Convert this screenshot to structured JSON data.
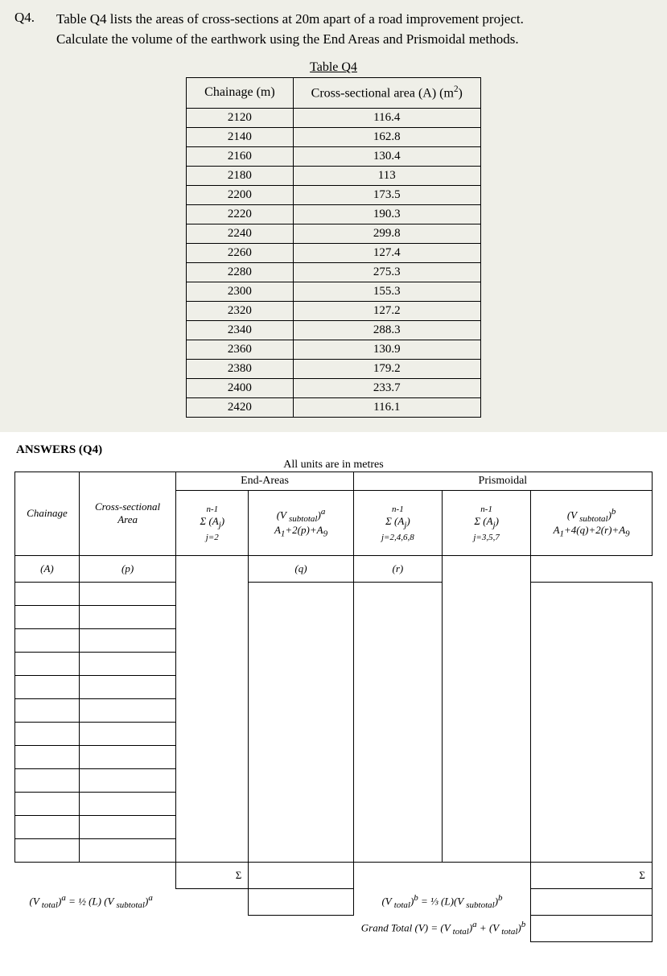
{
  "question": {
    "number": "Q4.",
    "text_line1": "Table Q4 lists the areas of cross-sections at 20m apart of a road improvement project.",
    "text_line2": "Calculate the volume of the earthwork using the End Areas and Prismoidal methods."
  },
  "data_table": {
    "caption": "Table Q4",
    "col1": "Chainage (m)",
    "col2_prefix": "Cross-sectional area (A)  (m",
    "col2_sup": "2",
    "col2_suffix": ")",
    "rows": [
      {
        "c": "2120",
        "a": "116.4"
      },
      {
        "c": "2140",
        "a": "162.8"
      },
      {
        "c": "2160",
        "a": "130.4"
      },
      {
        "c": "2180",
        "a": "113"
      },
      {
        "c": "2200",
        "a": "173.5"
      },
      {
        "c": "2220",
        "a": "190.3"
      },
      {
        "c": "2240",
        "a": "299.8"
      },
      {
        "c": "2260",
        "a": "127.4"
      },
      {
        "c": "2280",
        "a": "275.3"
      },
      {
        "c": "2300",
        "a": "155.3"
      },
      {
        "c": "2320",
        "a": "127.2"
      },
      {
        "c": "2340",
        "a": "288.3"
      },
      {
        "c": "2360",
        "a": "130.9"
      },
      {
        "c": "2380",
        "a": "179.2"
      },
      {
        "c": "2400",
        "a": "233.7"
      },
      {
        "c": "2420",
        "a": "116.1"
      }
    ]
  },
  "answers": {
    "title": "ANSWERS (Q4)",
    "units_note": "All units are in metres",
    "section_endareas": "End-Areas",
    "section_prismoidal": "Prismoidal",
    "headers": {
      "chainage": "Chainage",
      "cross_area_l1": "Cross-sectional",
      "cross_area_l2": "Area",
      "sum_top": "n-1",
      "sum_aj": "Σ (A",
      "sum_aj_sub": "j",
      "sum_aj_close": ")",
      "j2": "j=2",
      "j2468": "j=2,4,6,8",
      "j357": "j=3,5,7",
      "vsub_a_l1": "(V ",
      "vsub_sub": "subtotal",
      "vsub_close_a": ")",
      "sup_a": "a",
      "sup_b": "b",
      "vsub_a_l2_pre": "A",
      "vsub_a_l2_sub1": "1",
      "vsub_a_l2_mid": "+2(p)+A",
      "vsub_a_l2_sub9": "9",
      "vsub_b_l2_mid": "+4(q)+2(r)+A"
    },
    "row2": {
      "A": "(A)",
      "p": "(p)",
      "q": "(q)",
      "r": "(r)"
    },
    "sigma": "Σ",
    "formula_a_pre": "(V ",
    "formula_a_sub1": "total",
    "formula_a_mid": ")",
    "formula_a_eq": " = ½ (L) (V ",
    "formula_a_sub2": "subtotal",
    "formula_b_eq": " = ⅓ (L)(V ",
    "grand_pre": "Grand Total (V) = (V ",
    "grand_mid": " + (V "
  }
}
